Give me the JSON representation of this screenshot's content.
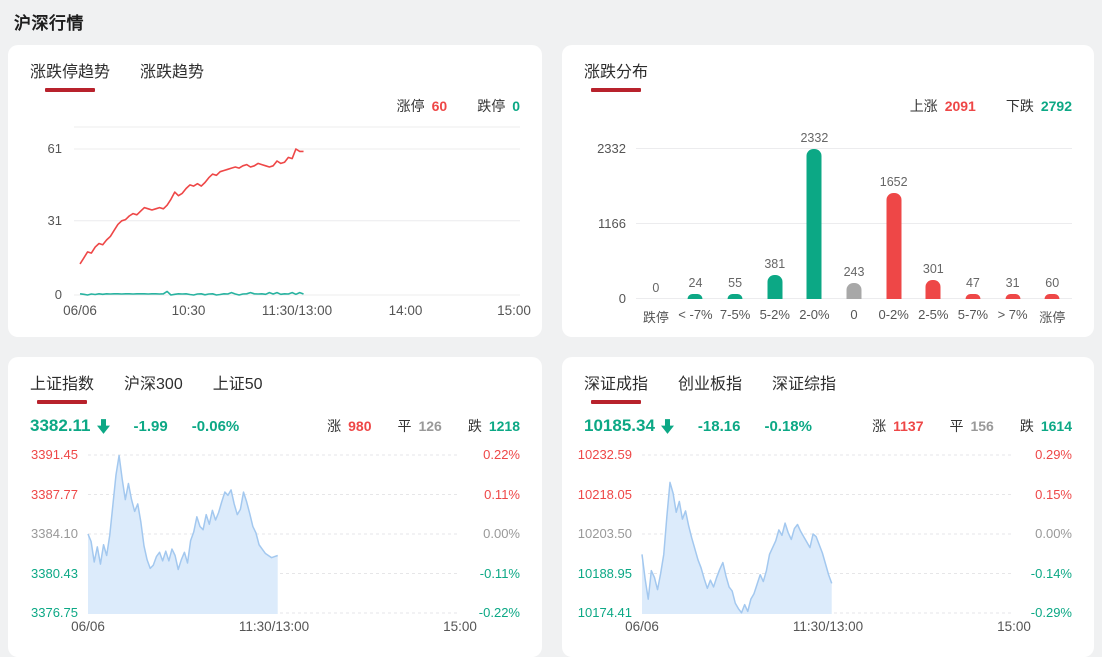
{
  "page": {
    "title": "沪深行情"
  },
  "colors": {
    "red": "#ee4747",
    "teal": "#0ca885",
    "teal_line": "#29b3a0",
    "gray": "#999999",
    "underline": "#b8222c",
    "grid": "#ececee",
    "bar_gray": "#a8a8a8",
    "area_fill": "#dcebfb",
    "area_line": "#a3c8ef"
  },
  "trend_panel": {
    "tabs": [
      {
        "label": "涨跌停趋势",
        "active": true
      },
      {
        "label": "涨跌趋势",
        "active": false
      }
    ],
    "stats": [
      {
        "label": "涨停",
        "value": "60",
        "color": "red"
      },
      {
        "label": "跌停",
        "value": "0",
        "color": "teal"
      }
    ]
  },
  "dist_panel": {
    "tabs": [
      {
        "label": "涨跌分布",
        "active": true
      }
    ],
    "stats": [
      {
        "label": "上涨",
        "value": "2091",
        "color": "red"
      },
      {
        "label": "下跌",
        "value": "2792",
        "color": "teal"
      }
    ]
  },
  "sse_panel": {
    "tabs": [
      {
        "label": "上证指数",
        "active": true
      },
      {
        "label": "沪深300",
        "active": false
      },
      {
        "label": "上证50",
        "active": false
      }
    ],
    "quote": {
      "value": "3382.11",
      "change": "-1.99",
      "pct": "-0.06%",
      "direction": "down"
    },
    "stats": [
      {
        "label": "涨",
        "value": "980",
        "color": "red"
      },
      {
        "label": "平",
        "value": "126",
        "color": "gray"
      },
      {
        "label": "跌",
        "value": "1218",
        "color": "teal"
      }
    ]
  },
  "szse_panel": {
    "tabs": [
      {
        "label": "深证成指",
        "active": true
      },
      {
        "label": "创业板指",
        "active": false
      },
      {
        "label": "深证综指",
        "active": false
      }
    ],
    "quote": {
      "value": "10185.34",
      "change": "-18.16",
      "pct": "-0.18%",
      "direction": "down"
    },
    "stats": [
      {
        "label": "涨",
        "value": "1137",
        "color": "red"
      },
      {
        "label": "平",
        "value": "156",
        "color": "gray"
      },
      {
        "label": "跌",
        "value": "1614",
        "color": "teal"
      }
    ]
  },
  "chart_data": [
    {
      "id": "trend",
      "type": "line",
      "title": "涨跌停趋势",
      "yticks": [
        61,
        31,
        0
      ],
      "ylim": [
        0,
        70
      ],
      "xticks": [
        "06/06",
        "10:30",
        "11:30/13:00",
        "14:00",
        "15:00"
      ],
      "data_end_fraction": 0.515,
      "legend_position": "none",
      "grid": true,
      "series": [
        {
          "name": "涨停",
          "color": "red",
          "values": [
            13,
            15.5,
            18,
            17.5,
            20,
            21.5,
            21,
            23,
            24.5,
            27,
            29.5,
            31,
            31.5,
            33,
            34,
            33.5,
            35,
            36.5,
            36,
            35.5,
            36,
            36.5,
            36,
            37.5,
            40,
            43,
            41.5,
            42.5,
            44.5,
            46,
            45.5,
            46.5,
            45.5,
            47,
            49,
            50.5,
            50,
            51.5,
            52,
            52.5,
            53,
            53.5,
            53,
            54,
            54.5,
            53.5,
            54,
            55,
            54.5,
            54,
            53.5,
            54,
            56,
            55,
            55.5,
            57.5,
            57,
            61,
            60,
            60
          ]
        },
        {
          "name": "跌停",
          "color": "teal_line",
          "values": [
            0.5,
            0.3,
            0,
            0.4,
            0.2,
            0.5,
            0.3,
            0.5,
            0.4,
            0.5,
            0.5,
            0.4,
            0.5,
            0.5,
            0.4,
            0.5,
            0.5,
            0.5,
            0.4,
            0.5,
            0.5,
            0.4,
            0.5,
            1.5,
            0,
            0.3,
            0.5,
            0.4,
            0.5,
            0.2,
            0,
            0.4,
            0.5,
            0.1,
            0.4,
            0.5,
            0,
            0.2,
            0.5,
            0.4,
            1,
            0.4,
            0,
            0.4,
            0.5,
            1,
            0.5,
            0.4,
            0.5,
            0.3,
            1,
            0.4,
            1,
            0.3,
            0.5,
            0.4,
            1,
            0.3,
            1,
            0.4
          ]
        }
      ]
    },
    {
      "id": "distribution",
      "type": "bar",
      "title": "涨跌分布",
      "categories": [
        "跌停",
        "< -7%",
        "7-5%",
        "5-2%",
        "2-0%",
        "0",
        "0-2%",
        "2-5%",
        "5-7%",
        "> 7%",
        "涨停"
      ],
      "values": [
        0,
        24,
        55,
        381,
        2332,
        243,
        1652,
        301,
        47,
        31,
        60
      ],
      "bar_colors": [
        "teal",
        "teal",
        "teal",
        "teal",
        "teal",
        "bar_gray",
        "red",
        "red",
        "red",
        "red",
        "red"
      ],
      "yticks": [
        2332,
        1166,
        0
      ],
      "ylim": [
        0,
        2332
      ],
      "grid": true
    },
    {
      "id": "sse_intraday",
      "type": "area",
      "title": "上证指数分时",
      "yticks_left": [
        "3391.45",
        "3387.77",
        "3384.10",
        "3380.43",
        "3376.75"
      ],
      "yticks_right": [
        "0.22%",
        "0.11%",
        "0.00%",
        "-0.11%",
        "-0.22%"
      ],
      "ytick_colors": [
        "red",
        "red",
        "gray",
        "teal",
        "teal"
      ],
      "ylim": [
        3376.75,
        3391.45
      ],
      "prev_close": 3384.1,
      "xticks": [
        "06/06",
        "11:30/13:00",
        "15:00"
      ],
      "data_end_fraction": 0.51,
      "grid": true,
      "values": [
        3384.1,
        3383.4,
        3381.5,
        3382.9,
        3381.3,
        3383.1,
        3382.1,
        3384.0,
        3386.8,
        3389.6,
        3391.4,
        3389.2,
        3387.3,
        3388.8,
        3387.3,
        3386.2,
        3386.9,
        3385.2,
        3383.0,
        3381.7,
        3380.9,
        3381.2,
        3382.0,
        3382.4,
        3381.6,
        3382.5,
        3381.6,
        3382.7,
        3382.1,
        3380.8,
        3381.7,
        3382.4,
        3381.4,
        3383.5,
        3384.3,
        3385.7,
        3384.8,
        3384.5,
        3385.9,
        3385.0,
        3386.3,
        3385.4,
        3386.1,
        3387.1,
        3388.0,
        3387.7,
        3388.2,
        3386.9,
        3385.9,
        3386.4,
        3388.0,
        3387.1,
        3386.0,
        3384.8,
        3384.2,
        3383.1,
        3382.7,
        3382.3,
        3382.1,
        3381.9,
        3382.0,
        3382.1
      ]
    },
    {
      "id": "szse_intraday",
      "type": "area",
      "title": "深证成指分时",
      "yticks_left": [
        "10232.59",
        "10218.05",
        "10203.50",
        "10188.95",
        "10174.41"
      ],
      "yticks_right": [
        "0.29%",
        "0.15%",
        "0.00%",
        "-0.14%",
        "-0.29%"
      ],
      "ytick_colors": [
        "red",
        "red",
        "gray",
        "teal",
        "teal"
      ],
      "ylim": [
        10174.41,
        10232.59
      ],
      "prev_close": 10203.5,
      "xticks": [
        "06/06",
        "11:30/13:00",
        "15:00"
      ],
      "data_end_fraction": 0.51,
      "grid": true,
      "values": [
        10196,
        10187,
        10179.5,
        10190,
        10187.5,
        10183,
        10189,
        10196,
        10210,
        10222.5,
        10218.5,
        10211.5,
        10215.5,
        10209,
        10212,
        10206.5,
        10202,
        10198,
        10194,
        10191,
        10187,
        10183.5,
        10186.5,
        10184,
        10187.5,
        10190.5,
        10193,
        10188,
        10184,
        10182.5,
        10178,
        10176,
        10174.5,
        10177.5,
        10175,
        10179.5,
        10181.5,
        10185,
        10188.5,
        10186,
        10190,
        10196,
        10198.5,
        10201,
        10205,
        10203,
        10207.5,
        10204,
        10201.5,
        10205.5,
        10207,
        10204.5,
        10202.5,
        10200.5,
        10198.5,
        10203.5,
        10202.5,
        10199.5,
        10196.5,
        10192.5,
        10188.5,
        10185.3
      ]
    }
  ]
}
